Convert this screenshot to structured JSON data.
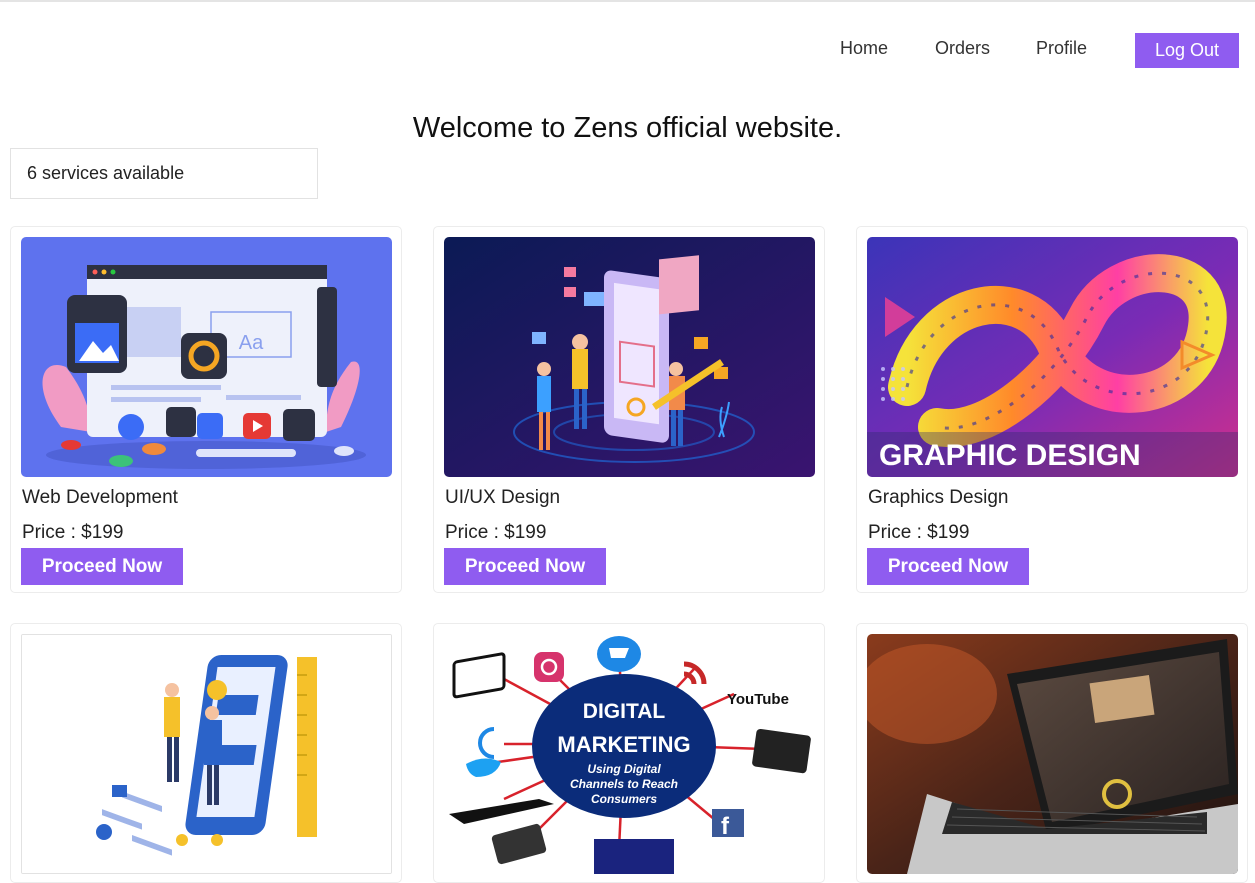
{
  "nav": {
    "home": "Home",
    "orders": "Orders",
    "profile": "Profile",
    "logout": "Log Out"
  },
  "welcome": "Welcome to Zens official website.",
  "search": {
    "value": "6 services available"
  },
  "services": [
    {
      "title": "Web Development",
      "price_label": "Price : ",
      "price": "$199",
      "button": "Proceed Now",
      "image_icon": "web-development-illustration",
      "image_text": "Aa"
    },
    {
      "title": "UI/UX Design",
      "price_label": "Price : ",
      "price": "$199",
      "button": "Proceed Now",
      "image_icon": "ui-ux-illustration"
    },
    {
      "title": "Graphics Design",
      "price_label": "Price : ",
      "price": "$199",
      "button": "Proceed Now",
      "image_icon": "graphic-design-banner",
      "image_text": "GRAPHIC DESIGN"
    },
    {
      "image_icon": "app-development-illustration"
    },
    {
      "image_icon": "digital-marketing-diagram",
      "image_text": [
        "DIGITAL",
        "MARKETING",
        "Using Digital",
        "Channels to Reach",
        "Consumers"
      ],
      "logo_text": "YouTube"
    },
    {
      "image_icon": "laptop-photo"
    }
  ],
  "colors": {
    "accent": "#8f5cf0",
    "border": "#ececec"
  }
}
